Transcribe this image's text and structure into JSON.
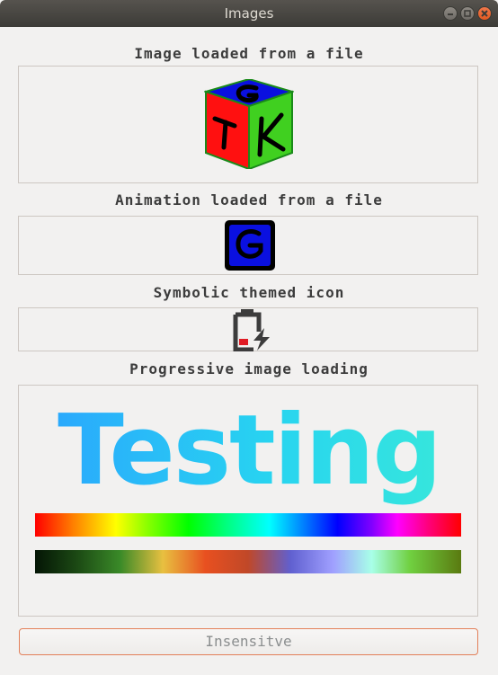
{
  "window": {
    "title": "Images",
    "controls": [
      "minimize-icon",
      "maximize-icon",
      "close-icon"
    ]
  },
  "sections": {
    "file_image": {
      "label": "Image loaded from a file",
      "icon": "gtk-cube-logo"
    },
    "animation": {
      "label": "Animation loaded from a file",
      "icon": "gtk-g-animation"
    },
    "symbolic": {
      "label": "Symbolic themed icon",
      "icon": "battery-low-charging-icon"
    },
    "progressive": {
      "label": "Progressive image loading",
      "text": "Testing",
      "text_colors": [
        "#2aa2ff",
        "#39ead8"
      ]
    }
  },
  "button": {
    "label": "Insensitve",
    "enabled": false
  }
}
